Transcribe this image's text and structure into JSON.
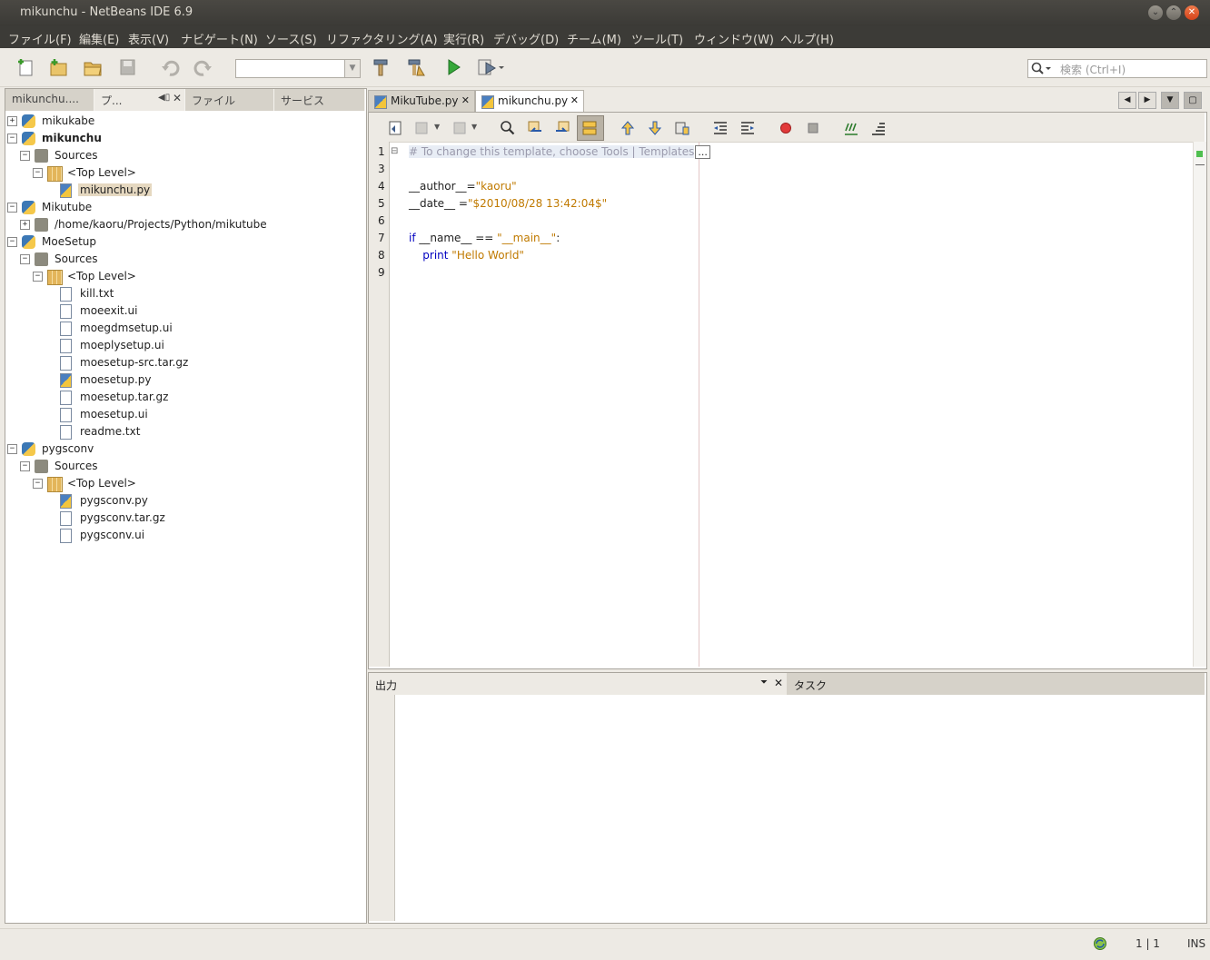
{
  "window": {
    "title": "mikunchu - NetBeans IDE 6.9"
  },
  "menu": [
    "ファイル(F)",
    "編集(E)",
    "表示(V)",
    "ナビゲート(N)",
    "ソース(S)",
    "リファクタリング(A)",
    "実行(R)",
    "デバッグ(D)",
    "チーム(M)",
    "ツール(T)",
    "ウィンドウ(W)",
    "ヘルプ(H)"
  ],
  "toolbar": {
    "config_combo_value": "",
    "search_placeholder": "検索 (Ctrl+I)"
  },
  "left_tabs": [
    "mikunchu....",
    "プ...",
    "ファイル",
    "サービス"
  ],
  "tree": [
    {
      "label": "mikukabe",
      "expander": "+",
      "icon": "python-project-icon"
    },
    {
      "label": "mikunchu",
      "expander": "−",
      "icon": "python-project-icon"
    },
    {
      "label": "Sources",
      "expander": "−",
      "icon": "sources-icon"
    },
    {
      "label": "<Top Level>",
      "expander": "−",
      "icon": "package-icon"
    },
    {
      "label": "mikunchu.py",
      "expander": "",
      "icon": "python-file-icon"
    },
    {
      "label": "Mikutube",
      "expander": "−",
      "icon": "python-project-icon"
    },
    {
      "label": "/home/kaoru/Projects/Python/mikutube",
      "expander": "+",
      "icon": "sources-icon"
    },
    {
      "label": "MoeSetup",
      "expander": "−",
      "icon": "python-project-icon"
    },
    {
      "label": "Sources",
      "expander": "−",
      "icon": "sources-icon"
    },
    {
      "label": "<Top Level>",
      "expander": "−",
      "icon": "package-icon"
    },
    {
      "label": "kill.txt",
      "expander": "",
      "icon": "file-icon"
    },
    {
      "label": "moeexit.ui",
      "expander": "",
      "icon": "file-icon"
    },
    {
      "label": "moegdmsetup.ui",
      "expander": "",
      "icon": "file-icon"
    },
    {
      "label": "moeplysetup.ui",
      "expander": "",
      "icon": "file-icon"
    },
    {
      "label": "moesetup-src.tar.gz",
      "expander": "",
      "icon": "file-icon"
    },
    {
      "label": "moesetup.py",
      "expander": "",
      "icon": "python-file-icon"
    },
    {
      "label": "moesetup.tar.gz",
      "expander": "",
      "icon": "file-icon"
    },
    {
      "label": "moesetup.ui",
      "expander": "",
      "icon": "file-icon"
    },
    {
      "label": "readme.txt",
      "expander": "",
      "icon": "file-icon"
    },
    {
      "label": "pygsconv",
      "expander": "−",
      "icon": "python-project-icon"
    },
    {
      "label": "Sources",
      "expander": "−",
      "icon": "sources-icon"
    },
    {
      "label": "<Top Level>",
      "expander": "−",
      "icon": "package-icon"
    },
    {
      "label": "pygsconv.py",
      "expander": "",
      "icon": "python-file-icon"
    },
    {
      "label": "pygsconv.tar.gz",
      "expander": "",
      "icon": "file-icon"
    },
    {
      "label": "pygsconv.ui",
      "expander": "",
      "icon": "file-icon"
    }
  ],
  "editor_tabs": [
    {
      "label": "MikuTube.py",
      "active": false
    },
    {
      "label": "mikunchu.py",
      "active": true
    }
  ],
  "code_lines": [
    {
      "num": "1",
      "tokens": [
        {
          "t": "# To change this template, choose Tools | Templates",
          "c": "cm"
        }
      ],
      "fold": true
    },
    {
      "num": "3",
      "tokens": []
    },
    {
      "num": "4",
      "tokens": [
        {
          "t": "__author__",
          "c": ""
        },
        {
          "t": "=",
          "c": ""
        },
        {
          "t": "\"kaoru\"",
          "c": "str"
        }
      ]
    },
    {
      "num": "5",
      "tokens": [
        {
          "t": "__date__ ",
          "c": ""
        },
        {
          "t": "=",
          "c": ""
        },
        {
          "t": "\"$2010/08/28 13:42:04$\"",
          "c": "str"
        }
      ]
    },
    {
      "num": "6",
      "tokens": []
    },
    {
      "num": "7",
      "tokens": [
        {
          "t": "if",
          "c": "kw"
        },
        {
          "t": " __name__ == ",
          "c": ""
        },
        {
          "t": "\"__main__\"",
          "c": "str"
        },
        {
          "t": ":",
          "c": ""
        }
      ]
    },
    {
      "num": "8",
      "tokens": [
        {
          "t": "    ",
          "c": ""
        },
        {
          "t": "print",
          "c": "kw"
        },
        {
          "t": " ",
          "c": ""
        },
        {
          "t": "\"Hello World\"",
          "c": "str"
        }
      ]
    },
    {
      "num": "9",
      "tokens": []
    }
  ],
  "fold_collapsed_marker": "...",
  "output_panel": {
    "output_tab": "出力",
    "tasks_tab": "タスク"
  },
  "status": {
    "position": "1 | 1",
    "mode": "INS"
  }
}
